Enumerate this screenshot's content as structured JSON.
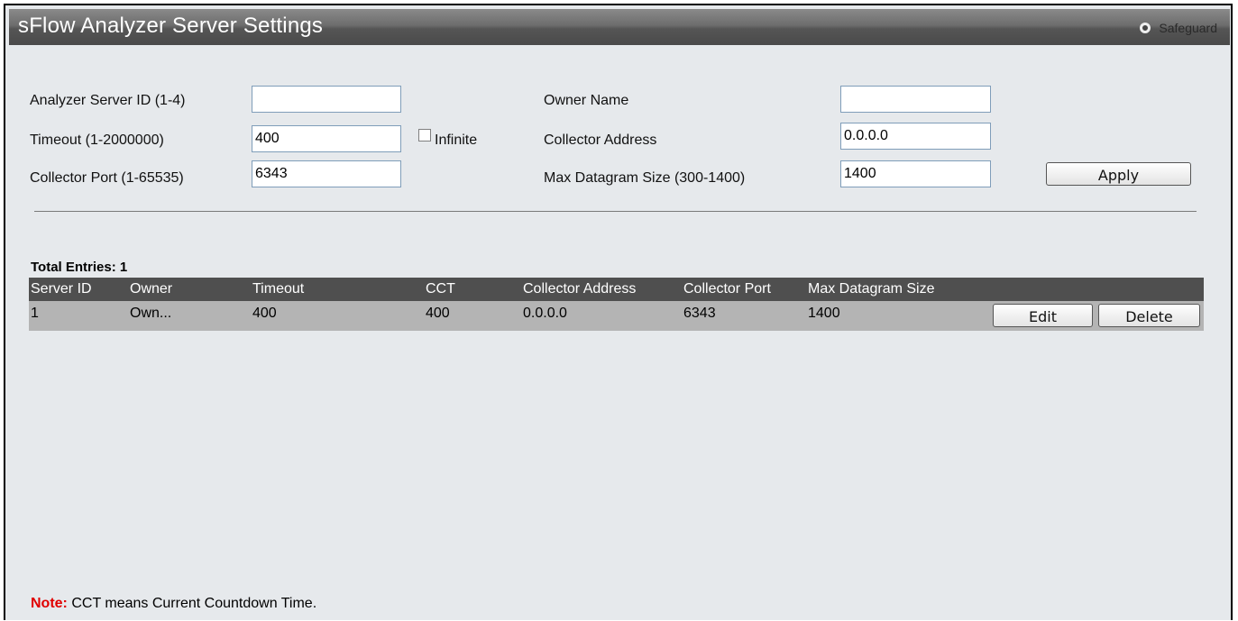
{
  "header": {
    "title": "sFlow Analyzer Server Settings",
    "safeguard_label": "Safeguard"
  },
  "form": {
    "analyzer_server_id": {
      "label": "Analyzer Server ID (1-4)",
      "value": ""
    },
    "timeout": {
      "label": "Timeout (1-2000000)",
      "value": "400"
    },
    "infinite": {
      "label": "Infinite",
      "checked": false
    },
    "collector_port": {
      "label": "Collector Port (1-65535)",
      "value": "6343"
    },
    "owner_name": {
      "label": "Owner Name",
      "value": ""
    },
    "collector_address": {
      "label": "Collector Address",
      "value": "0.0.0.0"
    },
    "max_datagram_size": {
      "label": "Max Datagram Size (300-1400)",
      "value": "1400"
    },
    "apply_label": "Apply"
  },
  "table": {
    "total_entries": "Total Entries: 1",
    "headers": [
      "Server ID",
      "Owner",
      "Timeout",
      "CCT",
      "Collector Address",
      "Collector Port",
      "Max Datagram Size"
    ],
    "rows": [
      {
        "server_id": "1",
        "owner": "Own...",
        "timeout": "400",
        "cct": "400",
        "collector_address": "0.0.0.0",
        "collector_port": "6343",
        "max_datagram_size": "1400",
        "edit_label": "Edit",
        "delete_label": "Delete"
      }
    ]
  },
  "note": {
    "label": "Note:",
    "text": " CCT means Current Countdown Time."
  },
  "colors": {
    "background": "#e6e9ec",
    "table_header": "#4f4f4f",
    "table_row": "#b4b4b4",
    "note_label": "#e00000"
  }
}
